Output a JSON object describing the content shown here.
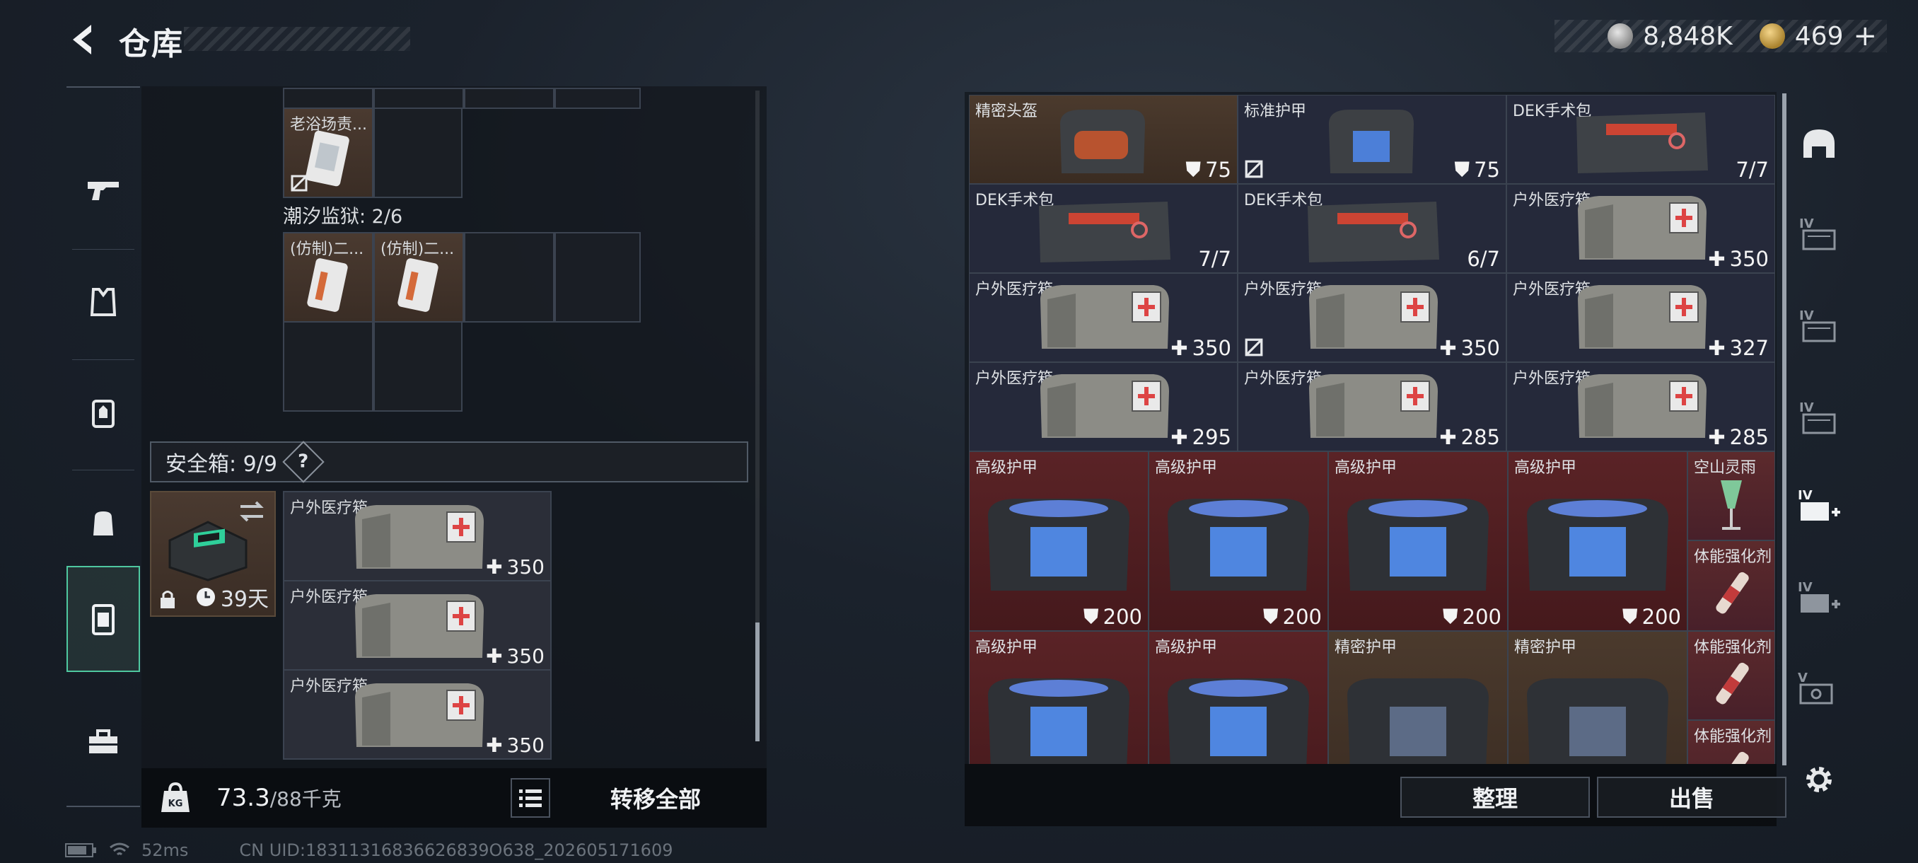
{
  "header": {
    "title": "仓库",
    "currency_silver": "8,848K",
    "currency_gold": "469",
    "currency_gold_plus": "+"
  },
  "left_nav": [
    "weapon-icon",
    "armor-vest-icon",
    "chest-rig-icon",
    "backpack-icon",
    "safe-box-icon",
    "toolbox-icon"
  ],
  "left_panel": {
    "top_item_label": "老浴场责...",
    "section_label": "潮汐监狱: 2/6",
    "section_items": [
      {
        "label": "(仿制)二..."
      },
      {
        "label": "(仿制)二..."
      }
    ],
    "safe_header": "安全箱: 9/9",
    "safe_help": "?",
    "safe_days": "39天",
    "safe_items": [
      {
        "label": "户外医疗箱",
        "value": "350"
      },
      {
        "label": "户外医疗箱",
        "value": "350"
      },
      {
        "label": "户外医疗箱",
        "value": "350"
      }
    ],
    "weight_current": "73.3",
    "weight_capacity": "/88千克",
    "transfer_all": "转移全部"
  },
  "status_bar": {
    "ping": "52ms",
    "uid": "CN UID:18311316836626839O638_202605171609"
  },
  "right_panel": {
    "rows_top": [
      [
        {
          "label": "精密头盔",
          "value": "75",
          "type": "shield",
          "bg": "brown",
          "mark": false
        },
        {
          "label": "标准护甲",
          "value": "75",
          "type": "shield",
          "bg": "navy",
          "mark": true
        },
        {
          "label": "DEK手术包",
          "value": "7/7",
          "type": "none",
          "bg": "navy",
          "mark": false
        }
      ],
      [
        {
          "label": "DEK手术包",
          "value": "7/7",
          "type": "none",
          "bg": "navy",
          "mark": false
        },
        {
          "label": "DEK手术包",
          "value": "6/7",
          "type": "none",
          "bg": "navy",
          "mark": false
        },
        {
          "label": "户外医疗箱",
          "value": "350",
          "type": "plus",
          "bg": "navy",
          "mark": false
        }
      ],
      [
        {
          "label": "户外医疗箱",
          "value": "350",
          "type": "plus",
          "bg": "navy",
          "mark": false
        },
        {
          "label": "户外医疗箱",
          "value": "350",
          "type": "plus",
          "bg": "navy",
          "mark": true
        },
        {
          "label": "户外医疗箱",
          "value": "327",
          "type": "plus",
          "bg": "navy",
          "mark": false
        }
      ],
      [
        {
          "label": "户外医疗箱",
          "value": "295",
          "type": "plus",
          "bg": "navy",
          "mark": false
        },
        {
          "label": "户外医疗箱",
          "value": "285",
          "type": "plus",
          "bg": "navy",
          "mark": false
        },
        {
          "label": "户外医疗箱",
          "value": "285",
          "type": "plus",
          "bg": "navy",
          "mark": false
        }
      ]
    ],
    "armor_row1": [
      {
        "label": "高级护甲",
        "value": "200"
      },
      {
        "label": "高级护甲",
        "value": "200"
      },
      {
        "label": "高级护甲",
        "value": "200"
      },
      {
        "label": "高级护甲",
        "value": "200"
      }
    ],
    "armor_row2": [
      {
        "label": "高级护甲",
        "bg": "red"
      },
      {
        "label": "高级护甲",
        "bg": "red"
      },
      {
        "label": "精密护甲",
        "bg": "brown"
      },
      {
        "label": "精密护甲",
        "bg": "brown"
      }
    ],
    "small_items": [
      {
        "label": "空山灵雨"
      },
      {
        "label": "体能强化剂"
      },
      {
        "label": "体能强化剂"
      },
      {
        "label": "体能强化剂"
      }
    ],
    "sort_button": "整理",
    "sell_button": "出售"
  },
  "right_nav": [
    "helmet-icon",
    "storage-tab-iv-1-icon",
    "storage-tab-iv-2-icon",
    "storage-tab-iv-3-icon",
    "storage-tab-iv-add-icon",
    "storage-tab-iv-add-2-icon",
    "storage-tab-v-icon",
    "settings-icon"
  ],
  "right_nav_labels": {
    "iv": "IV",
    "v": "V"
  },
  "colors": {
    "accent_active": "#4fc8a0",
    "rarity_red": "#5a2326",
    "rarity_brown": "#4b3a2d",
    "rarity_navy": "#25293a"
  }
}
